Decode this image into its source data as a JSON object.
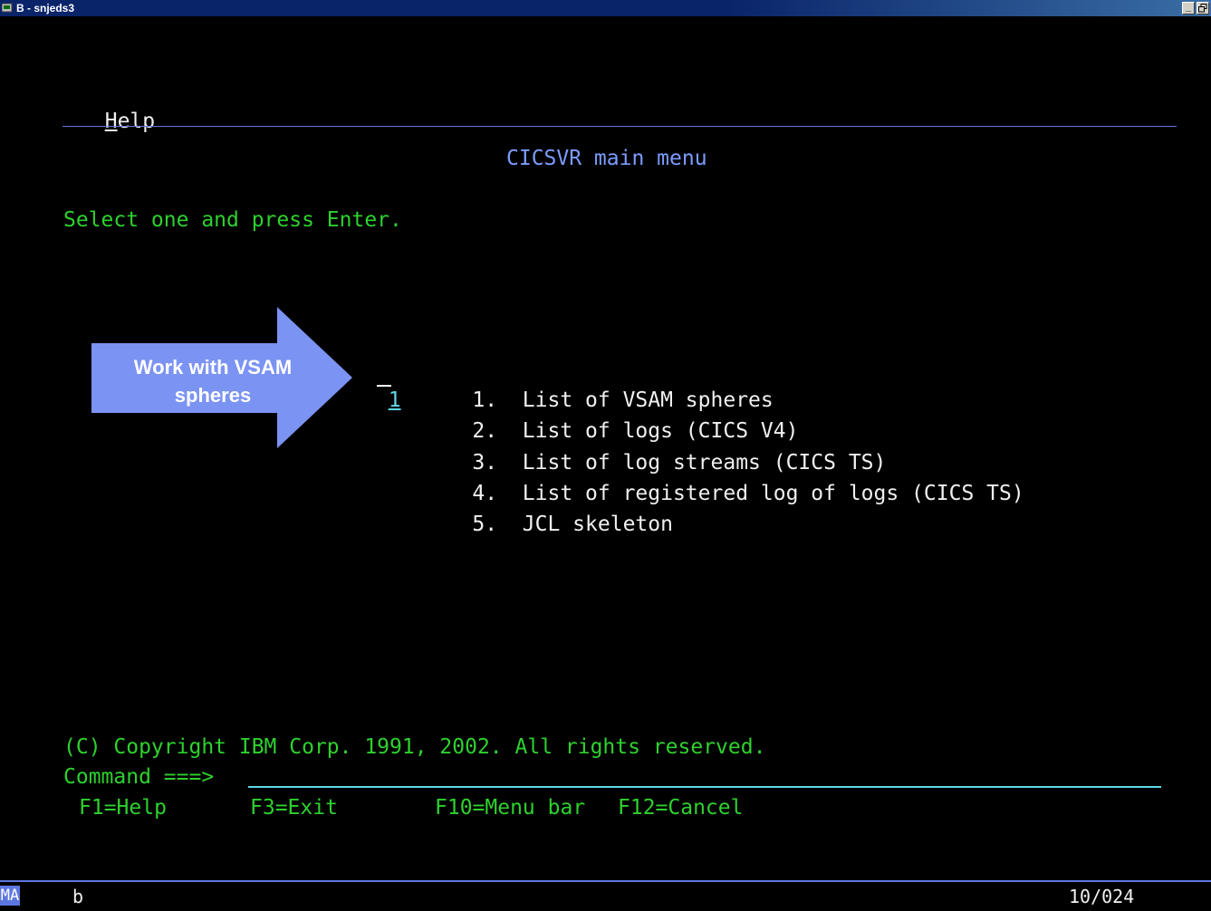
{
  "window": {
    "title": "B - snjeds3",
    "minimize_label": "_",
    "restore_label": "1"
  },
  "menu_bar": {
    "help_hotkey": "H",
    "help_rest": "elp"
  },
  "panel": {
    "title": "CICSVR main menu",
    "instruction": "Select one and press Enter.",
    "selection_value": "1",
    "options": [
      {
        "number": "1.",
        "label": "List of VSAM spheres"
      },
      {
        "number": "2.",
        "label": "List of logs (CICS V4)"
      },
      {
        "number": "3.",
        "label": "List of log streams (CICS TS)"
      },
      {
        "number": "4.",
        "label": "List of registered log of logs (CICS TS)"
      },
      {
        "number": "5.",
        "label": "JCL skeleton"
      }
    ],
    "copyright": "(C) Copyright IBM Corp. 1991, 2002. All rights reserved.",
    "command_label": "Command ===>",
    "command_value": "",
    "function_keys": [
      {
        "label": "F1=Help"
      },
      {
        "label": "F3=Exit"
      },
      {
        "label": "F10=Menu bar"
      },
      {
        "label": "F12=Cancel"
      }
    ]
  },
  "callout": {
    "text_line1": "Work with VSAM",
    "text_line2": "spheres",
    "color": "#7b93f2"
  },
  "status": {
    "mode": "MA",
    "session": "b",
    "cursor": "10/024"
  },
  "colors": {
    "green": "#2ed12e",
    "blue": "#7c9cff",
    "cyan": "#5fd7e6",
    "white": "#f0f0f0"
  }
}
